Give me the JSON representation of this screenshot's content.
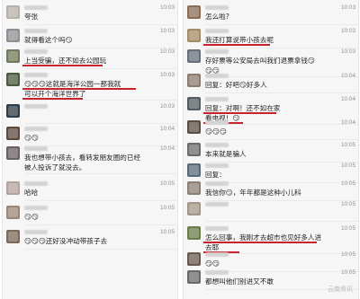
{
  "left": {
    "messages": [
      {
        "text": "夸张",
        "time": "10:03",
        "avatar": "#b7b0a8"
      },
      {
        "text": "就得看这个吗😏",
        "time": "10:03",
        "avatar": "#8e8f93"
      },
      {
        "text": "上当受骗，还不如去公园玩",
        "time": "10:03",
        "avatar": "#6f7a5a",
        "highlight": true
      },
      {
        "text": "😏😏😏这就是海洋公园一那我就",
        "text2": "可以开个海洋世界了",
        "time": "10:03",
        "avatar": "#4b5a3c",
        "highlight": true
      },
      {
        "text": "",
        "time": "10:03",
        "avatar": "#2f3b44"
      },
      {
        "text": "😏😏",
        "time": "10:04",
        "avatar": "#5a4a3f"
      },
      {
        "text": "我也想带小孩去，看转发朋友圈的已经",
        "text2": "被人投诉了就没去。",
        "time": "10:04",
        "avatar": "#6b5f66"
      },
      {
        "text": "哈哈",
        "time": "10:05",
        "avatar": "#b3a2a0"
      },
      {
        "text": "😏😏",
        "time": "10:05",
        "avatar": "#9c8776"
      },
      {
        "text": "😏😏😏还好没冲动带孩子去",
        "time": "10:05",
        "avatar": "#7b6a58"
      }
    ]
  },
  "right": {
    "messages": [
      {
        "text": "怎么啦?",
        "time": "10:03",
        "avatar": "#8a6e58"
      },
      {
        "text": "我还打算说带小孩去呢",
        "time": "10:03",
        "avatar": "#a58c68",
        "highlight": true
      },
      {
        "text": "存好票等公安局去叫我们退票拿钱😏",
        "text2": "😏😏",
        "time": "10:03",
        "avatar": "#676f79"
      },
      {
        "text": "回复：好吧😏好多人",
        "time": "10:04",
        "avatar": "#8a7c6f"
      },
      {
        "text": "回复：对啊！还不如在家",
        "text2": "看电视！😏",
        "time": "10:04",
        "avatar": "#565d61",
        "highlight": true
      },
      {
        "text": "😏😏😏",
        "time": "10:04",
        "avatar": "#5a4f46"
      },
      {
        "text": "本来就是骗人",
        "time": "10:05",
        "avatar": "#6c6c6c"
      },
      {
        "text": "回复：",
        "time": "10:05",
        "avatar": "#5a6b78"
      },
      {
        "text": "我信你😏，年年都是这种小儿科",
        "time": "10:05",
        "avatar": "#8a8076"
      },
      {
        "text": "",
        "time": "10:05",
        "avatar": "#a29688"
      },
      {
        "text": "怎么回事，我刚才去超市也见好多人进",
        "text2": "去耶",
        "time": "10:05",
        "avatar": "#6d7c4a",
        "highlight": true
      },
      {
        "text": "😏😏",
        "time": "10:05",
        "avatar": "#6a5a52"
      },
      {
        "text": "都想叫他们别进又不敢",
        "time": "10:05",
        "avatar": "#6b6b6b"
      }
    ]
  },
  "watermark": "云南资讯"
}
